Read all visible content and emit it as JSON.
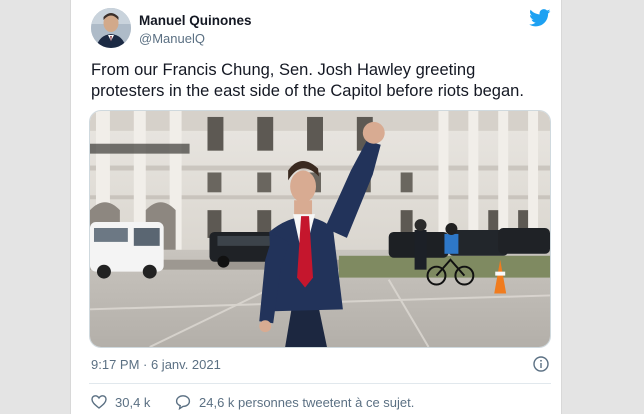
{
  "author": {
    "name": "Manuel Quinones",
    "handle": "@ManuelQ"
  },
  "tweet": {
    "text": "From our Francis Chung, Sen. Josh Hawley greeting protesters in the east side of the Capitol before riots began.",
    "timestamp": "9:17 PM · 6 janv. 2021"
  },
  "stats": {
    "likes": "30,4 k",
    "talking": "24,6 k personnes tweetent à ce sujet."
  },
  "icons": {
    "brand": "twitter-bird-icon",
    "info": "info-icon",
    "like": "heart-icon",
    "reply": "speech-bubble-icon"
  },
  "colors": {
    "brand": "#1da1f2",
    "text": "#141823",
    "muted": "#5b7083"
  }
}
